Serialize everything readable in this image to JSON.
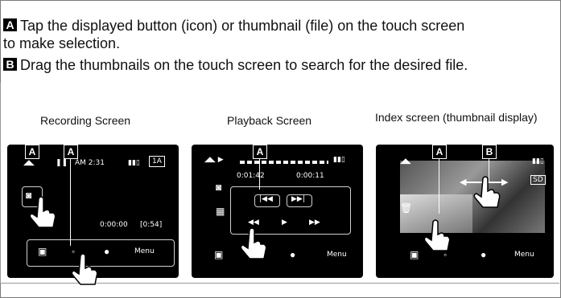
{
  "instructions": {
    "a_badge": "A",
    "a_line1": "Tap the displayed button (icon) or thumbnail (file) on the touch screen",
    "a_line2": "to make selection.",
    "b_badge": "B",
    "b_line": "Drag the thumbnails on the touch screen to search for the desired file."
  },
  "panels": {
    "recording": {
      "title": "Recording Screen",
      "tags": [
        "A",
        "A"
      ],
      "status_left": "AM 2:31",
      "timecode": "0:00:00",
      "remaining": "[0:54]",
      "menu_label": "Menu"
    },
    "playback": {
      "title": "Playback Screen",
      "tags": [
        "A"
      ],
      "elapsed": "0:01:42",
      "total": "0:00:11",
      "menu_label": "Menu"
    },
    "index": {
      "title": "Index screen (thumbnail display)",
      "tags": [
        "A",
        "B"
      ],
      "menu_label": "Menu"
    }
  },
  "icons": [
    "touch-hand-icon",
    "camera-icon",
    "playback-icon",
    "info-icon",
    "trash-icon",
    "battery-icon"
  ]
}
